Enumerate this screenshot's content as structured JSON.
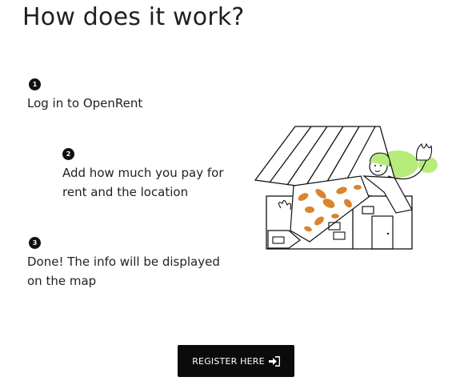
{
  "page": {
    "title": "How does it work?"
  },
  "steps": [
    {
      "number": "1",
      "text": "Log in to OpenRent"
    },
    {
      "number": "2",
      "text": "Add how much you pay for rent and the location"
    },
    {
      "number": "3",
      "text": "Done! The info will be displayed on the map"
    }
  ],
  "register_button": {
    "label": "REGISTER HERE",
    "icon": "sign-in-icon"
  },
  "illustration": {
    "icon": "house-with-waving-person-illustration",
    "colors": {
      "line": "#111111",
      "orange": "#d9852f",
      "green": "#b7ec7a"
    }
  },
  "colors": {
    "button_background": "#0b0b0b",
    "button_text": "#ffffff",
    "text": "#222222",
    "badge": "#111111"
  }
}
